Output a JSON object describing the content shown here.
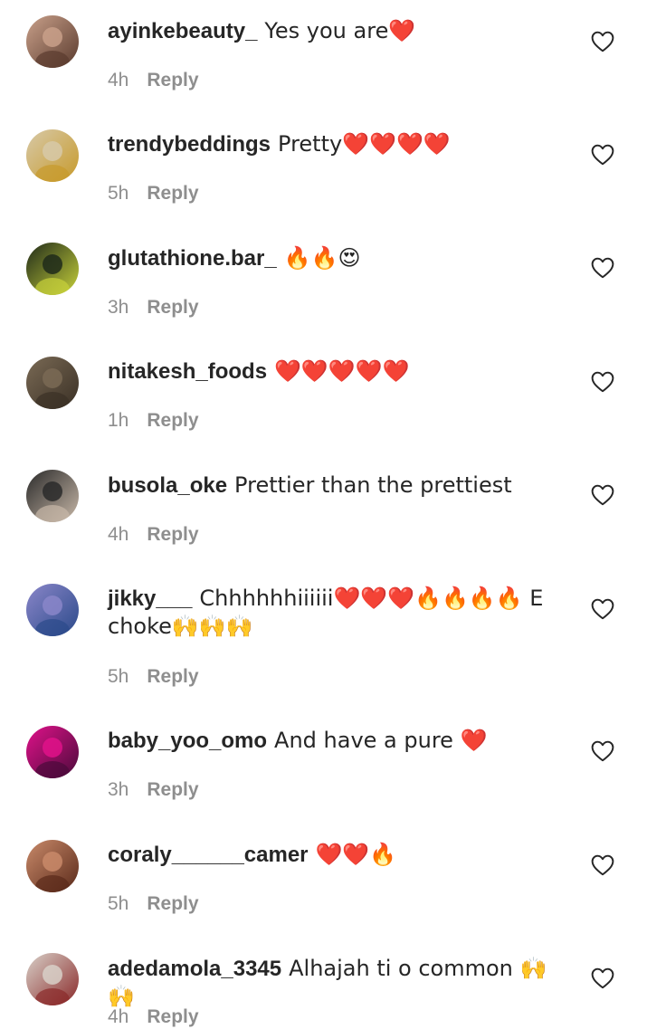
{
  "reply_label": "Reply",
  "comments": [
    {
      "username": "ayinkebeauty_",
      "text": "Yes you are❤️",
      "time": "4h",
      "avatar_colors": [
        "#c9a08a",
        "#5a3b2e"
      ]
    },
    {
      "username": "trendybeddings",
      "text": "Pretty❤️❤️❤️❤️",
      "time": "5h",
      "avatar_colors": [
        "#d7c9a8",
        "#c79a2b"
      ]
    },
    {
      "username": "glutathione.bar_",
      "text": "🔥🔥😍",
      "time": "3h",
      "avatar_colors": [
        "#1f2a1a",
        "#c7d13a"
      ]
    },
    {
      "username": "nitakesh_foods",
      "text": "❤️❤️❤️❤️❤️",
      "time": "1h",
      "avatar_colors": [
        "#7a6a55",
        "#3a3025"
      ]
    },
    {
      "username": "busola_oke",
      "text": "Prettier than the prettiest",
      "time": "4h",
      "avatar_colors": [
        "#2a2a2a",
        "#c8b8a8"
      ]
    },
    {
      "username": "jikky___",
      "text": "Chhhhhhiiiiii❤️❤️❤️🔥🔥🔥🔥 E choke🙌🙌🙌",
      "time": "5h",
      "avatar_colors": [
        "#8a86c9",
        "#2b4a8a"
      ]
    },
    {
      "username": "baby_yoo_omo",
      "text": "And have a pure ❤️",
      "time": "3h",
      "avatar_colors": [
        "#e0128a",
        "#4a0a3a"
      ]
    },
    {
      "username": "coraly______camer",
      "text": "❤️❤️🔥",
      "time": "5h",
      "avatar_colors": [
        "#c98a6a",
        "#5a2a1a"
      ]
    },
    {
      "username": "adedamola_3345",
      "text": "Alhajah ti o common 🙌🙌",
      "time": "4h",
      "avatar_colors": [
        "#d8d0c8",
        "#8a2a2a"
      ]
    }
  ]
}
